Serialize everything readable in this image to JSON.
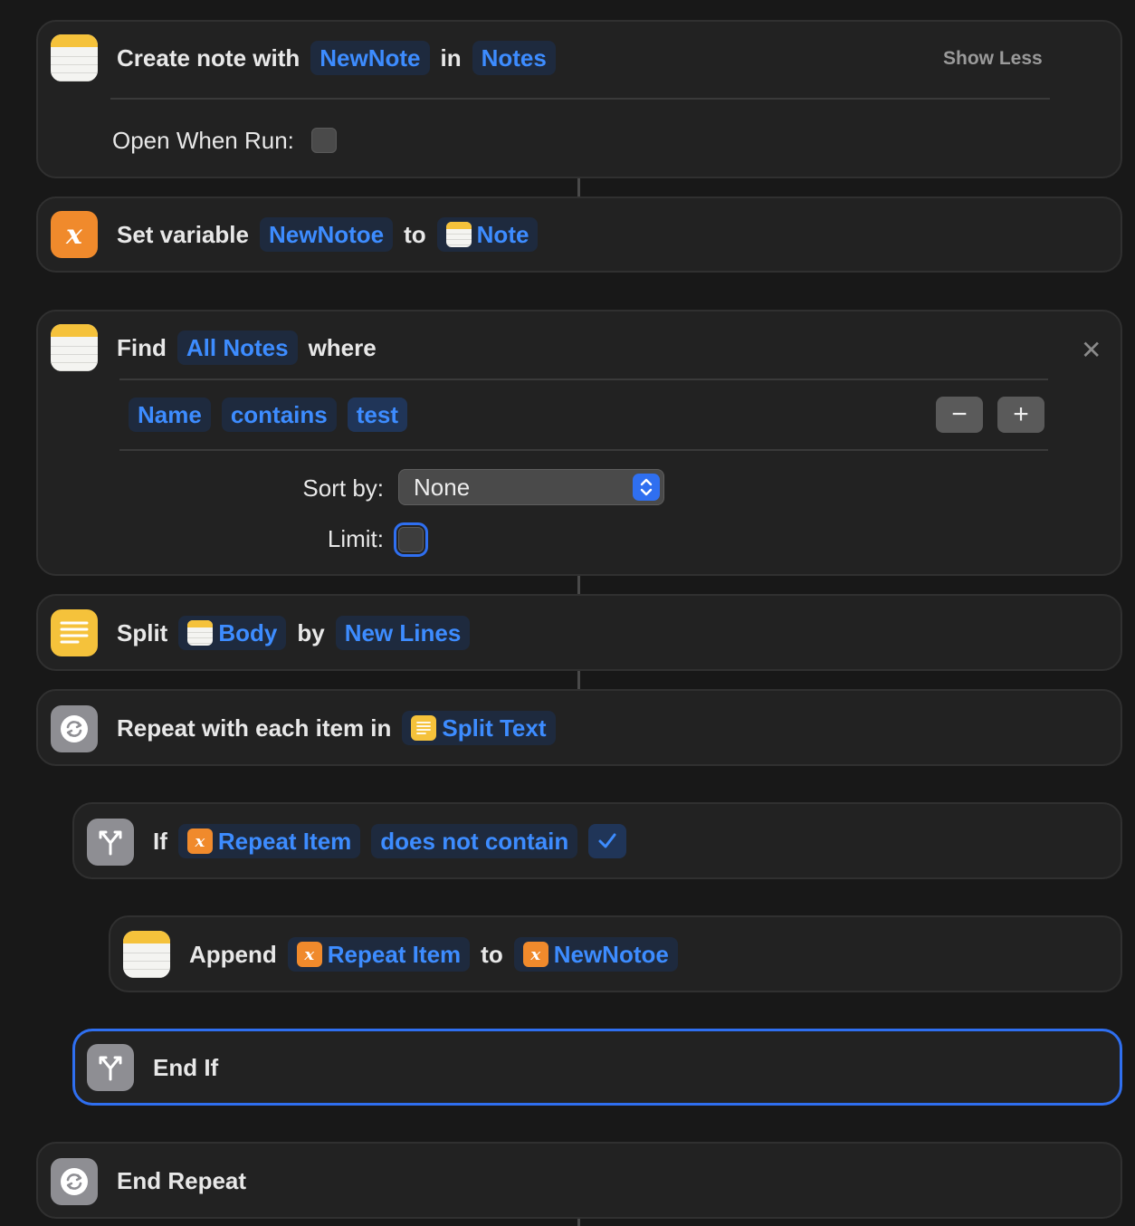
{
  "colors": {
    "accent": "#3d8cff",
    "background": "#181818",
    "card": "#222222",
    "selection": "#2f6ff0"
  },
  "create_note": {
    "action": "Create note with",
    "content_token": "NewNote",
    "in": "in",
    "folder_token": "Notes",
    "show_less": "Show Less",
    "open_when_run_label": "Open When Run:"
  },
  "set_variable": {
    "action": "Set variable",
    "variable_token": "NewNotoe",
    "to": "to",
    "value_token": "Note"
  },
  "find_notes": {
    "action": "Find",
    "scope_token": "All Notes",
    "where": "where",
    "filter": {
      "field": "Name",
      "operator": "contains",
      "value": "test"
    },
    "remove_filter": "−",
    "add_filter": "+",
    "sort_by_label": "Sort by:",
    "sort_by_value": "None",
    "limit_label": "Limit:"
  },
  "split_text": {
    "action": "Split",
    "input_token": "Body",
    "by": "by",
    "separator_token": "New Lines"
  },
  "repeat": {
    "action": "Repeat with each item in",
    "input_token": "Split Text",
    "end_label": "End Repeat"
  },
  "if_block": {
    "action": "If",
    "input_token": "Repeat Item",
    "condition_token": "does not contain",
    "end_label": "End If"
  },
  "append": {
    "action": "Append",
    "input_token": "Repeat Item",
    "to": "to",
    "target_token": "NewNotoe"
  }
}
